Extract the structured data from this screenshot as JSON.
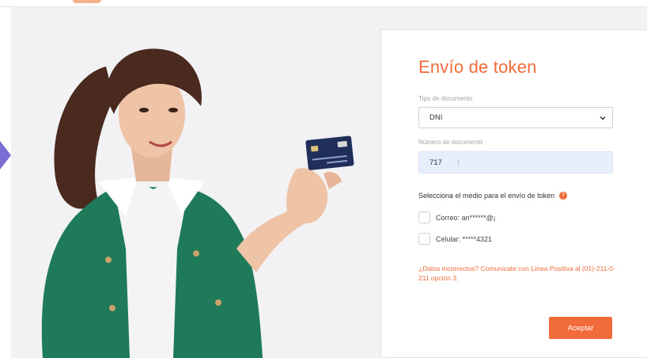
{
  "form": {
    "title": "Envío de token",
    "doc_type_label": "Tipo de documento",
    "doc_type_value": "DNI",
    "doc_number_label": "Número de documento",
    "doc_number_value": "717",
    "method_question": "Selecciona el medio para el envío de token",
    "info_icon_glyph": "!",
    "options": [
      {
        "label": "Correo: an******@¡",
        "checked": false
      },
      {
        "label": "Celular: *****4321",
        "checked": false
      }
    ],
    "warning_text": "¿Datos incorrectos? Comunicate con Línea Positiva al (01)-211-0-211 opción 3.",
    "submit_label": "Aceptar"
  },
  "colors": {
    "accent": "#f26b3a",
    "input_fill": "#e8effc",
    "slider_arrow": "#7b6fd6"
  },
  "icons": {
    "slider": "chevron-right-icon",
    "select": "chevron-down-icon",
    "info": "exclamation-circle-icon"
  }
}
